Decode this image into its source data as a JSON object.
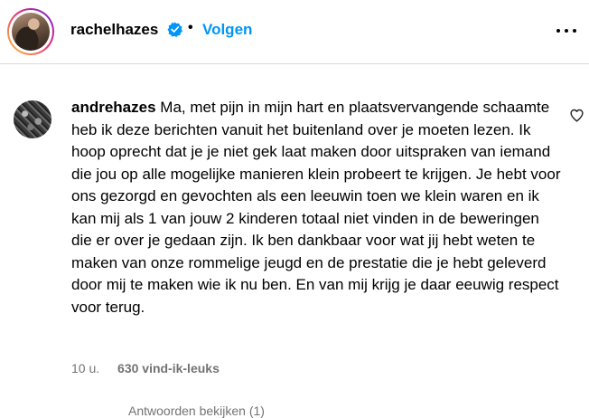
{
  "post_header": {
    "username": "rachelhazes",
    "separator": "•",
    "follow_label": "Volgen",
    "verified_icon": "verified-badge-icon",
    "more_icon": "more-options-icon"
  },
  "comment": {
    "author": "andrehazes",
    "text": "Ma, met pijn in mijn hart en plaatsvervangende schaamte heb ik deze berichten vanuit het buitenland over je moeten lezen. Ik hoop oprecht dat je je niet gek laat maken door uitspraken van iemand die jou op alle mogelijke manieren klein probeert te krijgen. Je hebt voor ons gezorgd en gevochten als een leeuwin toen we klein waren en ik kan mij als 1 van jouw 2 kinderen totaal niet vinden in de beweringen die er over je gedaan zijn. Ik ben dankbaar voor wat jij hebt weten te maken van onze rommelige jeugd en de prestatie die je hebt geleverd door mij te maken wie ik nu ben. En van mij krijg je daar eeuwig respect voor terug.",
    "time": "10 u.",
    "likes": "630 vind-ik-leuks",
    "like_icon": "heart-icon"
  },
  "replies_toggle": {
    "label": "Antwoorden bekijken (1)"
  },
  "colors": {
    "link_blue": "#0095f6",
    "muted_gray": "#737373",
    "divider": "#dbdbdb",
    "verified_blue": "#0095f6"
  }
}
